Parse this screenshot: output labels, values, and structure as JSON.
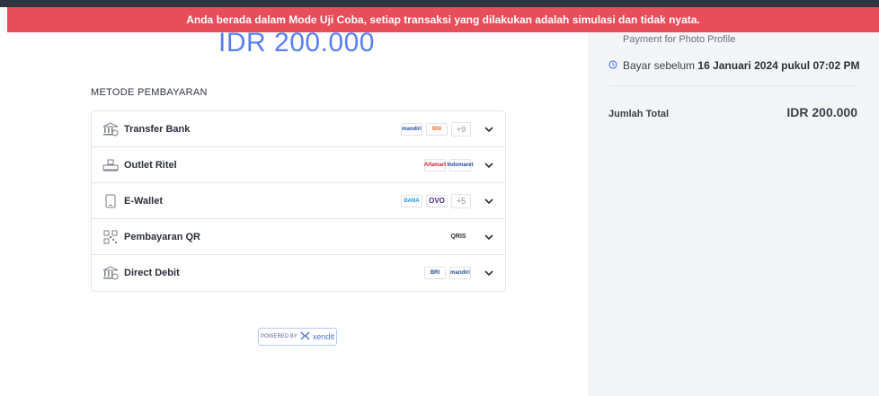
{
  "banner": {
    "text": "Anda berada dalam Mode Uji Coba, setiap transaksi yang dilakukan adalah simulasi dan tidak nyata.",
    "color": "#e84d5a"
  },
  "payment": {
    "amount": "IDR 200.000",
    "section_label": "METODE PEMBAYARAN",
    "methods": [
      {
        "label": "Transfer Bank",
        "icon": "bank-icon",
        "logos": [
          "mandiri",
          "BNI"
        ],
        "more": "+9"
      },
      {
        "label": "Outlet Ritel",
        "icon": "store-icon",
        "logos": [
          "Alfamart",
          "Indomaret"
        ],
        "more": ""
      },
      {
        "label": "E-Wallet",
        "icon": "phone-icon",
        "logos": [
          "DANA",
          "OVO"
        ],
        "more": "+5"
      },
      {
        "label": "Pembayaran QR",
        "icon": "qr-icon",
        "logos": [
          "QRIS"
        ],
        "more": ""
      },
      {
        "label": "Direct Debit",
        "icon": "bank-icon",
        "logos": [
          "BRI",
          "mandiri"
        ],
        "more": ""
      }
    ]
  },
  "footer": {
    "powered_by": "POWERED BY",
    "brand": "xendit"
  },
  "sidebar": {
    "description": "Payment for Photo Profile",
    "deadline_prefix": "Bayar sebelum",
    "deadline_value": "16 Januari 2024 pukul 07:02 PM",
    "total_label": "Jumlah Total",
    "total_value": "IDR 200.000"
  }
}
